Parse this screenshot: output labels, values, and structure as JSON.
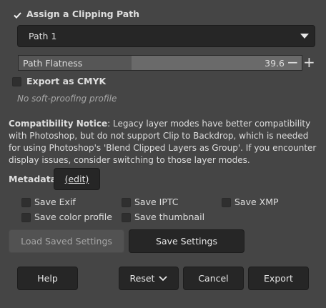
{
  "clipping": {
    "checkbox_label": "Assign a Clipping Path",
    "checked": true,
    "path_value": "Path 1",
    "flatness_label": "Path Flatness",
    "flatness_value": "39.6",
    "flatness_fraction": 0.4,
    "minus": "−",
    "plus": "+"
  },
  "cmyk": {
    "label": "Export as CMYK",
    "checked": false,
    "profile_text": "No soft-proofing profile"
  },
  "notice": {
    "title": "Compatibility Notice",
    "body": ": Legacy layer modes have better compatibility with Photoshop, but do not support Clip to Backdrop, which is needed for using Photoshop's 'Blend Clipped Layers as Group'. If you encounter display issues, consider switching to those layer modes."
  },
  "metadata": {
    "label": "Metadata",
    "edit_label": "(edit)",
    "options": {
      "save_exif": "Save Exif",
      "save_iptc": "Save IPTC",
      "save_xmp": "Save XMP",
      "save_color_profile": "Save color profile",
      "save_thumbnail": "Save thumbnail"
    }
  },
  "settings": {
    "load_label": "Load Saved Settings",
    "save_label": "Save Settings"
  },
  "footer": {
    "help": "Help",
    "reset": "Reset",
    "cancel": "Cancel",
    "export": "Export"
  }
}
